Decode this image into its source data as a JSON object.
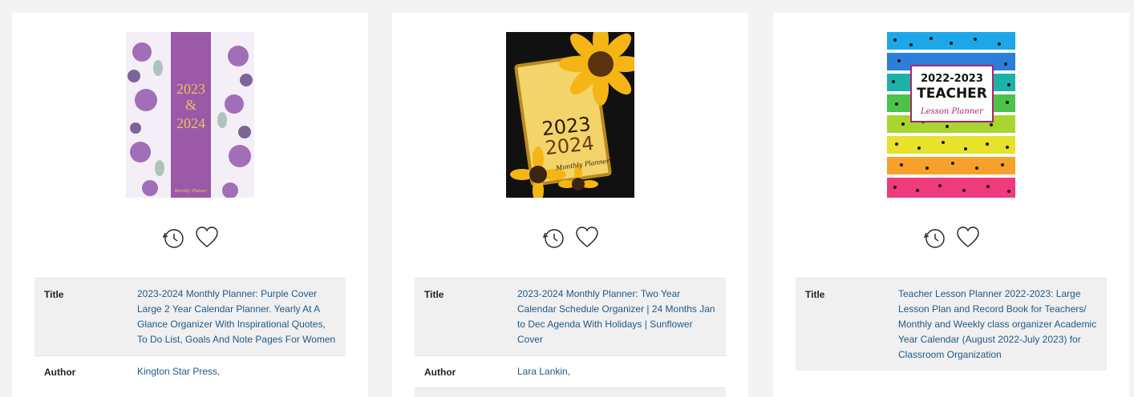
{
  "cards": [
    {
      "cover": {
        "alt_text": "2023-2024 planner cover",
        "lines": [
          "2023",
          "&",
          "2024"
        ],
        "footer": "Monthly Planner"
      },
      "details": [
        {
          "label": "Title",
          "value": "2023-2024 Monthly Planner: Purple Cover Large 2 Year Calendar Planner. Yearly At A Glance Organizer With Inspirational Quotes, To Do List, Goals And Note Pages For Women"
        },
        {
          "label": "Author",
          "value": "Kington Star Press,"
        }
      ]
    },
    {
      "cover": {
        "alt_text": "Sunflower planner cover",
        "lines": [
          "2023",
          "2024"
        ],
        "footer": "Monthly Planner"
      },
      "details": [
        {
          "label": "Title",
          "value": "2023-2024 Monthly Planner: Two Year Calendar Schedule Organizer | 24 Months Jan to Dec Agenda With Holidays | Sunflower Cover"
        },
        {
          "label": "Author",
          "value": "Lara Lankin,"
        }
      ]
    },
    {
      "cover": {
        "alt_text": "Teacher lesson planner cover",
        "lines": [
          "2022-2023",
          "TEACHER"
        ],
        "footer": "Lesson Planner"
      },
      "details": [
        {
          "label": "Title",
          "value": "Teacher Lesson Planner 2022-2023: Large Lesson Plan and Record Book for Teachers/ Monthly and Weekly class organizer Academic Year Calendar (August 2022-July 2023) for Classroom Organization"
        }
      ]
    }
  ],
  "icons": {
    "history": "clock-history-icon",
    "favorite": "heart-icon"
  },
  "colors": {
    "link": "#1d5a8a",
    "row_shade": "#f0f0f0",
    "purple_band": "#9b59a8",
    "sunflower_bg": "#111111"
  }
}
